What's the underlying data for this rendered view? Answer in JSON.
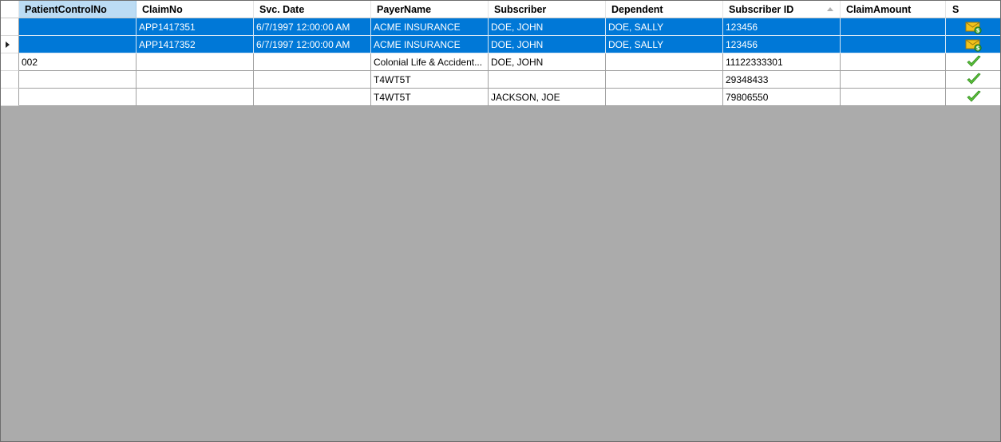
{
  "grid": {
    "columns": [
      {
        "label": "PatientControlNo"
      },
      {
        "label": "ClaimNo"
      },
      {
        "label": "Svc. Date"
      },
      {
        "label": "PayerName"
      },
      {
        "label": "Subscriber"
      },
      {
        "label": "Dependent"
      },
      {
        "label": "Subscriber ID"
      },
      {
        "label": "ClaimAmount"
      },
      {
        "label": "S"
      }
    ],
    "rows": [
      {
        "selected": true,
        "current": false,
        "patient": "",
        "claimno": "APP1417351",
        "svcdate": "6/7/1997 12:00:00 AM",
        "payer": "ACME INSURANCE",
        "subscriber": "DOE, JOHN",
        "dependent": "DOE, SALLY",
        "subid": "123456",
        "amount": "",
        "status_icon": "envelope-dollar-icon"
      },
      {
        "selected": true,
        "current": true,
        "patient": "",
        "claimno": "APP1417352",
        "svcdate": "6/7/1997 12:00:00 AM",
        "payer": "ACME INSURANCE",
        "subscriber": "DOE, JOHN",
        "dependent": "DOE, SALLY",
        "subid": "123456",
        "amount": "",
        "status_icon": "envelope-dollar-icon"
      },
      {
        "selected": false,
        "current": false,
        "patient": "002",
        "claimno": "",
        "svcdate": "",
        "payer": "Colonial Life & Accident...",
        "subscriber": "DOE, JOHN",
        "dependent": "",
        "subid": "11122333301",
        "amount": "",
        "status_icon": "green-check-icon"
      },
      {
        "selected": false,
        "current": false,
        "patient": "",
        "claimno": "",
        "svcdate": "",
        "payer": "T4WT5T",
        "subscriber": "",
        "dependent": "",
        "subid": "29348433",
        "amount": "",
        "status_icon": "green-check-icon"
      },
      {
        "selected": false,
        "current": false,
        "patient": "",
        "claimno": "",
        "svcdate": "",
        "payer": "T4WT5T",
        "subscriber": "JACKSON, JOE",
        "dependent": "",
        "subid": "79806550",
        "amount": "",
        "status_icon": "green-check-icon"
      }
    ],
    "colors": {
      "selection": "#0078d7",
      "active_header": "#bcdcf4",
      "empty_area": "#ababab"
    }
  }
}
